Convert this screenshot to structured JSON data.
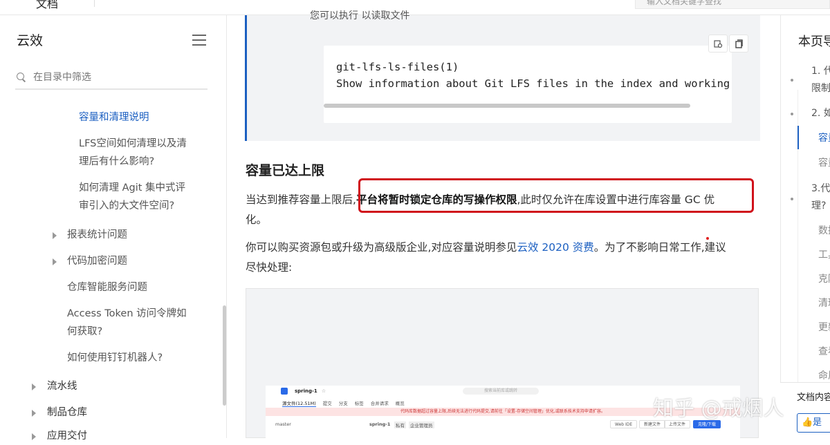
{
  "topbar": {
    "brand": "文档",
    "search_placeholder": "输入文档关键字查找"
  },
  "sidebar": {
    "title": "云效",
    "filter_placeholder": "在目录中筛选",
    "items": [
      {
        "label": "容量和清理说明"
      },
      {
        "label": "LFS空间如何清理以及清"
      },
      {
        "label": "理后有什么影响?"
      },
      {
        "label": "如何清理 Agit 集中式评"
      },
      {
        "label": "审引入的大文件空间?"
      },
      {
        "label": "报表统计问题"
      },
      {
        "label": "代码加密问题"
      },
      {
        "label": "仓库智能服务问题"
      },
      {
        "label": "Access Token 访问令牌如"
      },
      {
        "label": "何获取?"
      },
      {
        "label": "如何使用钉钉机器人?"
      },
      {
        "label": "流水线"
      },
      {
        "label": "制品仓库"
      },
      {
        "label": "应用交付"
      }
    ]
  },
  "main": {
    "quote_cut": "您可以执行    以读取文件",
    "code_lines": [
      "git-lfs-ls-files(1)",
      "Show information about Git LFS files in the index and working"
    ],
    "heading": "容量已达上限",
    "p1_before": "当达到推荐容量上限后,",
    "p1_bold": "平台将暂时锁定仓库的写操作权限",
    "p1_after": ",此时仅允许在库设置中进行库容量 GC 优",
    "p1_line2": "化。",
    "p2_before": "你可以购买资源包或升级为高级版企业,对应容量说明参见",
    "p2_link": "云效 2020 资费",
    "p2_after": "。为了不影响日常工作,建议",
    "p2_line2": "尽快处理:",
    "mini": {
      "repo": "spring-1",
      "search": "搜索当前库或跳转",
      "tabs": [
        "源文件(12.51M)",
        "提交",
        "分支",
        "标签",
        "合并请求",
        "概览"
      ],
      "warning": "代码库数据超过容量上限,后续无法进行代码提交,请前往「设置-存储空间管理」优化,或联系技术支持申请扩容。",
      "branch": "master",
      "repo2": "spring-1",
      "badge1": "私有",
      "badge2": "企业管理员",
      "btn_webide": "Web IDE",
      "btn_new": "新建文件",
      "btn_upload": "上传文件",
      "btn_clone": "克隆/下载"
    }
  },
  "toc": {
    "title": "本页导读",
    "items": [
      {
        "label": "1. 代"
      },
      {
        "label": "限制"
      },
      {
        "label": "2. 如"
      },
      {
        "label": "容量"
      },
      {
        "label": "容量"
      },
      {
        "label": "3.代"
      },
      {
        "label": "理?"
      },
      {
        "label": "数据"
      },
      {
        "label": "工具"
      },
      {
        "label": "克隆"
      },
      {
        "label": "清理"
      },
      {
        "label": "更新"
      },
      {
        "label": "查看"
      },
      {
        "label": "命周"
      }
    ],
    "bottom_label": "文档内容",
    "bottom_btn": "是"
  },
  "watermark": "知乎 @戒烟人"
}
